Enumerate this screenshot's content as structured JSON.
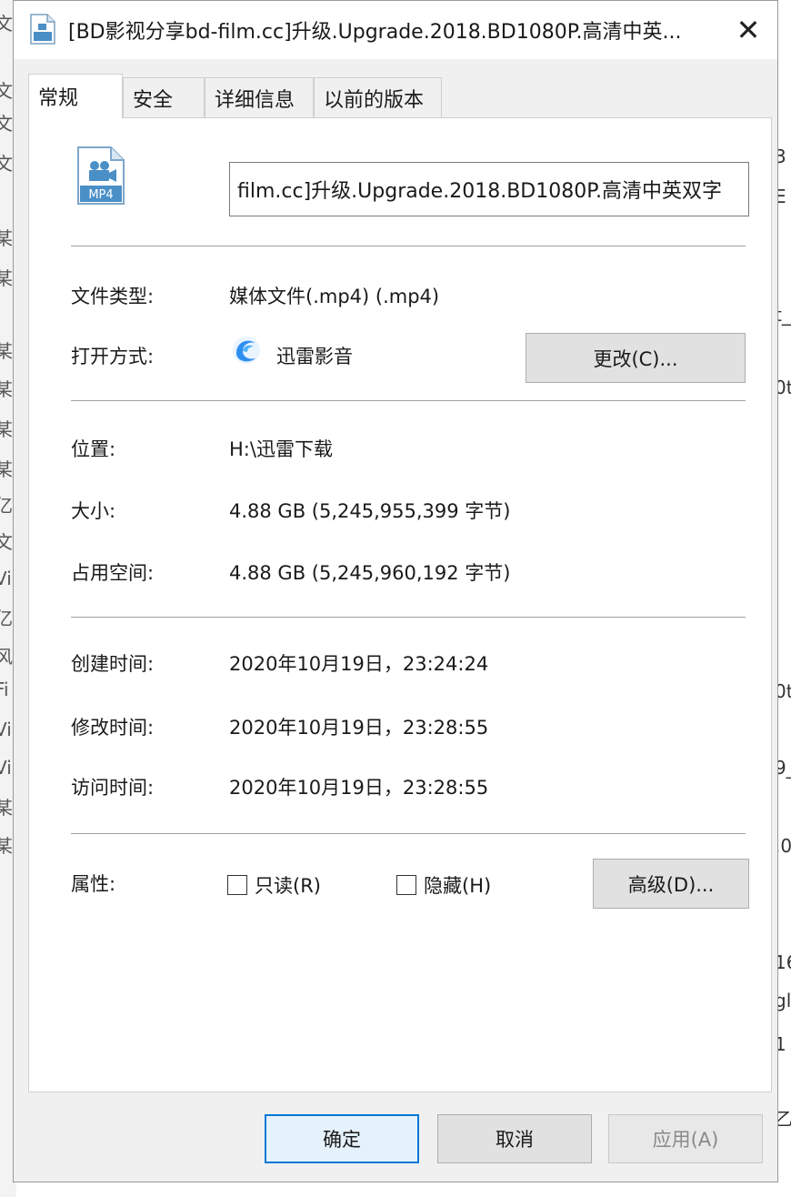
{
  "window": {
    "title": "[BD影视分享bd-film.cc]升级.Upgrade.2018.BD1080P.高清中英...",
    "close_label": "✕"
  },
  "tabs": [
    {
      "label": "常规",
      "active": true
    },
    {
      "label": "安全"
    },
    {
      "label": "详细信息"
    },
    {
      "label": "以前的版本"
    }
  ],
  "file": {
    "icon_label": "MP4",
    "name_value": "film.cc]升级.Upgrade.2018.BD1080P.高清中英双字"
  },
  "details": {
    "type_label": "文件类型:",
    "type_value": "媒体文件(.mp4) (.mp4)",
    "open_with_label": "打开方式:",
    "open_with_value": "迅雷影音",
    "change_button": "更改(C)...",
    "location_label": "位置:",
    "location_value": "H:\\迅雷下载",
    "size_label": "大小:",
    "size_value": "4.88 GB (5,245,955,399 字节)",
    "disk_size_label": "占用空间:",
    "disk_size_value": "4.88 GB (5,245,960,192 字节)",
    "created_label": "创建时间:",
    "created_value": "2020年10月19日，23:24:24",
    "modified_label": "修改时间:",
    "modified_value": "2020年10月19日，23:28:55",
    "accessed_label": "访问时间:",
    "accessed_value": "2020年10月19日，23:28:55",
    "attributes_label": "属性:",
    "readonly_label": "只读(R)",
    "readonly_checked": false,
    "hidden_label": "隐藏(H)",
    "hidden_checked": false,
    "advanced_button": "高级(D)..."
  },
  "footer": {
    "ok": "确定",
    "cancel": "取消",
    "apply": "应用(A)"
  },
  "colors": {
    "accent": "#0078d7",
    "dialog_bg": "#f0f0f0",
    "panel_bg": "#ffffff"
  },
  "background_window": {
    "left_fragments": [
      "文",
      "文",
      "文",
      "文",
      "某",
      "某",
      "某",
      "某",
      "某",
      "某",
      "亿",
      "文",
      "Vi",
      "亿",
      "风",
      "Fi",
      "Vi",
      "Vi",
      "某",
      "某"
    ],
    "right_fragments": [
      "3",
      "E",
      "t_",
      "0t",
      "0t",
      "9_",
      ".0",
      "16",
      "gl",
      "1",
      "乙"
    ]
  }
}
